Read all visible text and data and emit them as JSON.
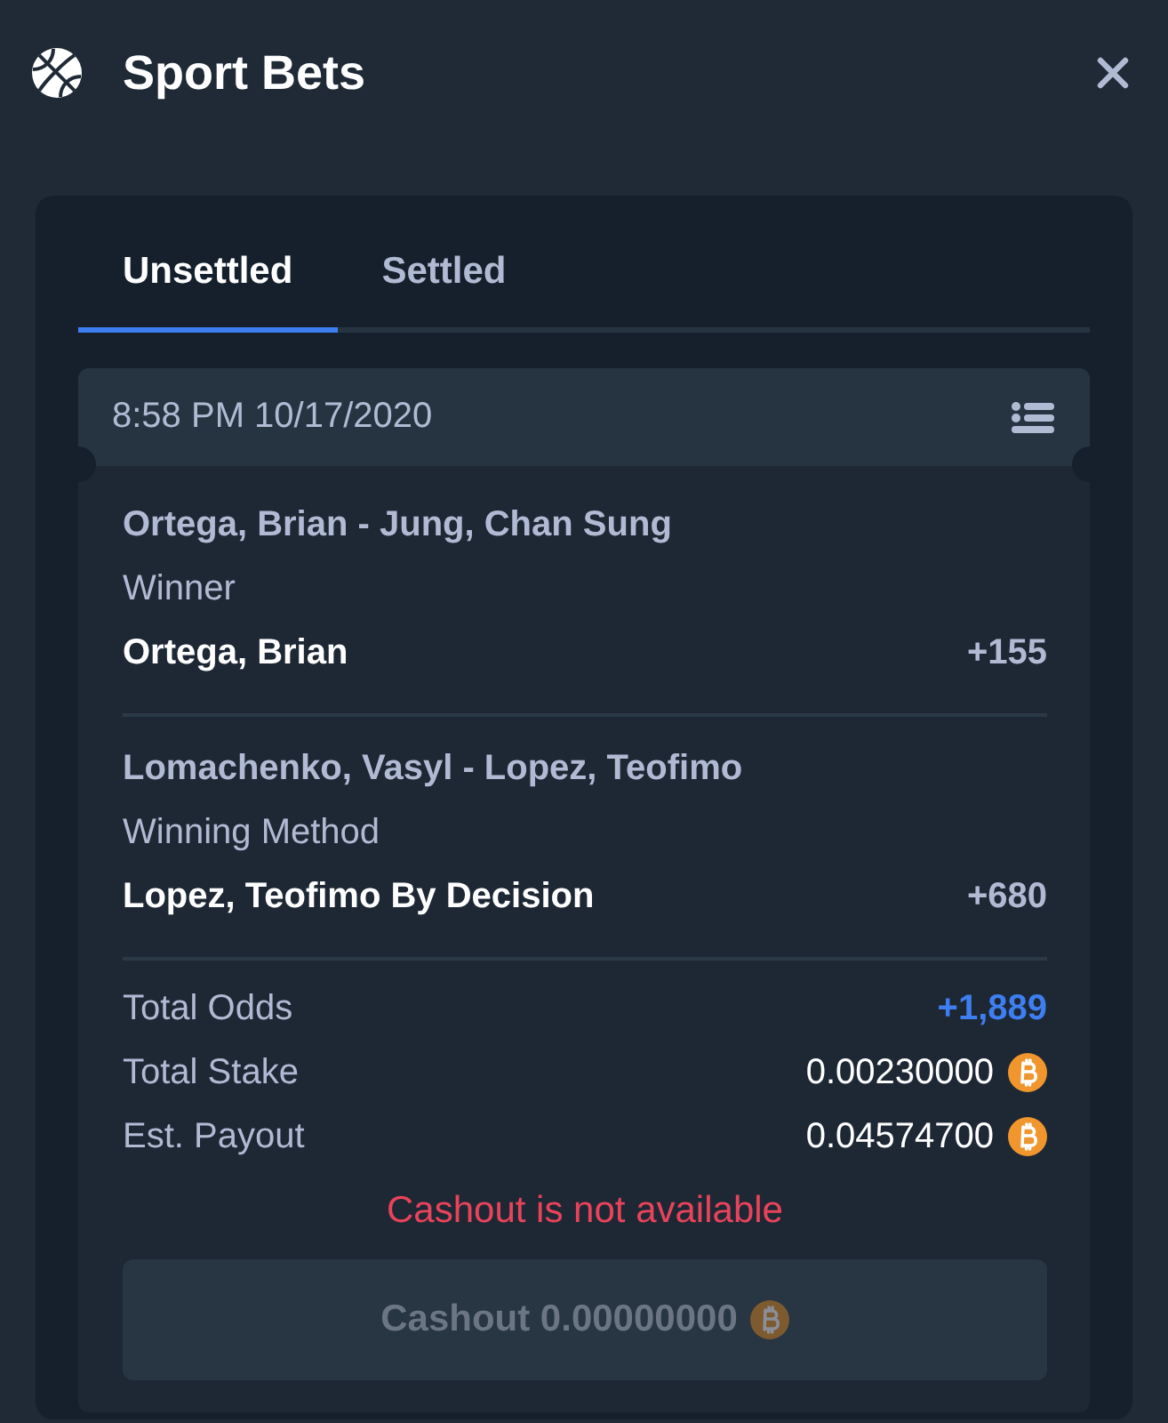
{
  "header": {
    "title": "Sport Bets"
  },
  "tabs": [
    {
      "label": "Unsettled",
      "selected": true
    },
    {
      "label": "Settled",
      "selected": false
    }
  ],
  "bet": {
    "time": "8:58 PM 10/17/2020",
    "selections": [
      {
        "match": "Ortega, Brian - Jung, Chan Sung",
        "market": "Winner",
        "pick": "Ortega, Brian",
        "odds": "+155"
      },
      {
        "match": "Lomachenko, Vasyl - Lopez, Teofimo",
        "market": "Winning Method",
        "pick": "Lopez, Teofimo By Decision",
        "odds": "+680"
      }
    ],
    "summary": [
      {
        "label": "Total Odds",
        "value": "+1,889",
        "kind": "odds"
      },
      {
        "label": "Total Stake",
        "value": "0.00230000",
        "kind": "coin"
      },
      {
        "label": "Est. Payout",
        "value": "0.04574700",
        "kind": "coin"
      }
    ],
    "cashout_notice": "Cashout is not available",
    "cashout_button": {
      "label": "Cashout 0.00000000",
      "disabled": true
    }
  }
}
